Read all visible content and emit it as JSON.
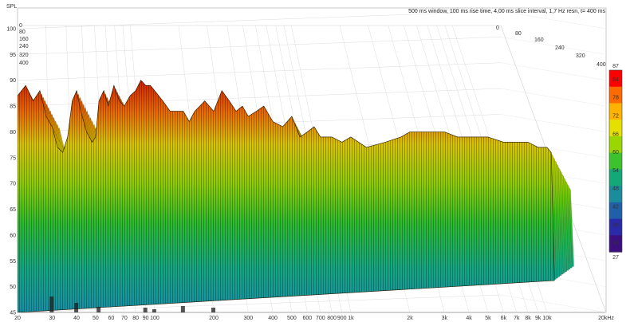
{
  "chart_data": {
    "type": "waterfall",
    "title": "500 ms window, 100 ms rise time, 4,00 ms slice interval, 1,7 Hz resn, t= 400 ms",
    "ylabel": "SPL",
    "y_ticks": [
      "45",
      "50",
      "55",
      "60",
      "65",
      "70",
      "75",
      "80",
      "85",
      "90",
      "95",
      "100"
    ],
    "x_ticks": [
      "20",
      "30",
      "40",
      "50",
      "60",
      "70",
      "80",
      "90",
      "100",
      "200",
      "300",
      "400",
      "500",
      "600",
      "700",
      "800",
      "900",
      "1k",
      "2k",
      "3k",
      "4k",
      "5k",
      "6k",
      "7k",
      "8k",
      "9k",
      "10k",
      "20kHz"
    ],
    "time_ticks_left": [
      "0",
      "80",
      "160",
      "240",
      "320",
      "400"
    ],
    "time_ticks_right": [
      "0",
      "80",
      "160",
      "240",
      "320",
      "400"
    ],
    "colorbar": {
      "ticks": [
        "84",
        "78",
        "72",
        "66",
        "60",
        "54",
        "48",
        "42",
        "36",
        "30"
      ],
      "max_label": "87",
      "min_label": "27",
      "colors": [
        "#ff0000",
        "#ff6a00",
        "#ffb300",
        "#e6e000",
        "#9ad600",
        "#3cc22c",
        "#12a878",
        "#1a8c9c",
        "#2060a8",
        "#2a2aa8",
        "#3b0f80"
      ]
    },
    "ylim": [
      45,
      100
    ],
    "xlim": [
      20,
      20000
    ],
    "x_scale": "log",
    "series": [
      {
        "values": [
          [
            20,
            87
          ],
          [
            22,
            89
          ],
          [
            24,
            86
          ],
          [
            26,
            88
          ],
          [
            28,
            83
          ],
          [
            30,
            81
          ],
          [
            32,
            77
          ],
          [
            34,
            76
          ],
          [
            36,
            79
          ],
          [
            38,
            86
          ],
          [
            40,
            88
          ],
          [
            42,
            84
          ],
          [
            45,
            80
          ],
          [
            48,
            78
          ],
          [
            50,
            79
          ],
          [
            52,
            86
          ],
          [
            55,
            88
          ],
          [
            58,
            85
          ],
          [
            62,
            89
          ],
          [
            66,
            86
          ],
          [
            70,
            85
          ],
          [
            75,
            87
          ],
          [
            80,
            88
          ],
          [
            85,
            90
          ],
          [
            90,
            89
          ],
          [
            95,
            89
          ],
          [
            100,
            88
          ],
          [
            110,
            86
          ],
          [
            120,
            84
          ],
          [
            130,
            84
          ],
          [
            140,
            84
          ],
          [
            150,
            82
          ],
          [
            160,
            84
          ],
          [
            170,
            85
          ],
          [
            180,
            86
          ],
          [
            200,
            84
          ],
          [
            220,
            88
          ],
          [
            240,
            86
          ],
          [
            260,
            84
          ],
          [
            280,
            85
          ],
          [
            300,
            83
          ],
          [
            330,
            84
          ],
          [
            360,
            85
          ],
          [
            400,
            82
          ],
          [
            450,
            81
          ],
          [
            500,
            83
          ],
          [
            550,
            79
          ],
          [
            600,
            80
          ],
          [
            650,
            81
          ],
          [
            700,
            79
          ],
          [
            800,
            79
          ],
          [
            900,
            78
          ],
          [
            1000,
            79
          ],
          [
            1200,
            77
          ],
          [
            1500,
            78
          ],
          [
            1800,
            79
          ],
          [
            2000,
            80
          ],
          [
            2500,
            80
          ],
          [
            3000,
            80
          ],
          [
            3500,
            79
          ],
          [
            4000,
            79
          ],
          [
            5000,
            79
          ],
          [
            6000,
            78
          ],
          [
            7000,
            78
          ],
          [
            8000,
            78
          ],
          [
            9000,
            77
          ],
          [
            10000,
            77
          ],
          [
            10500,
            76
          ]
        ]
      }
    ]
  }
}
